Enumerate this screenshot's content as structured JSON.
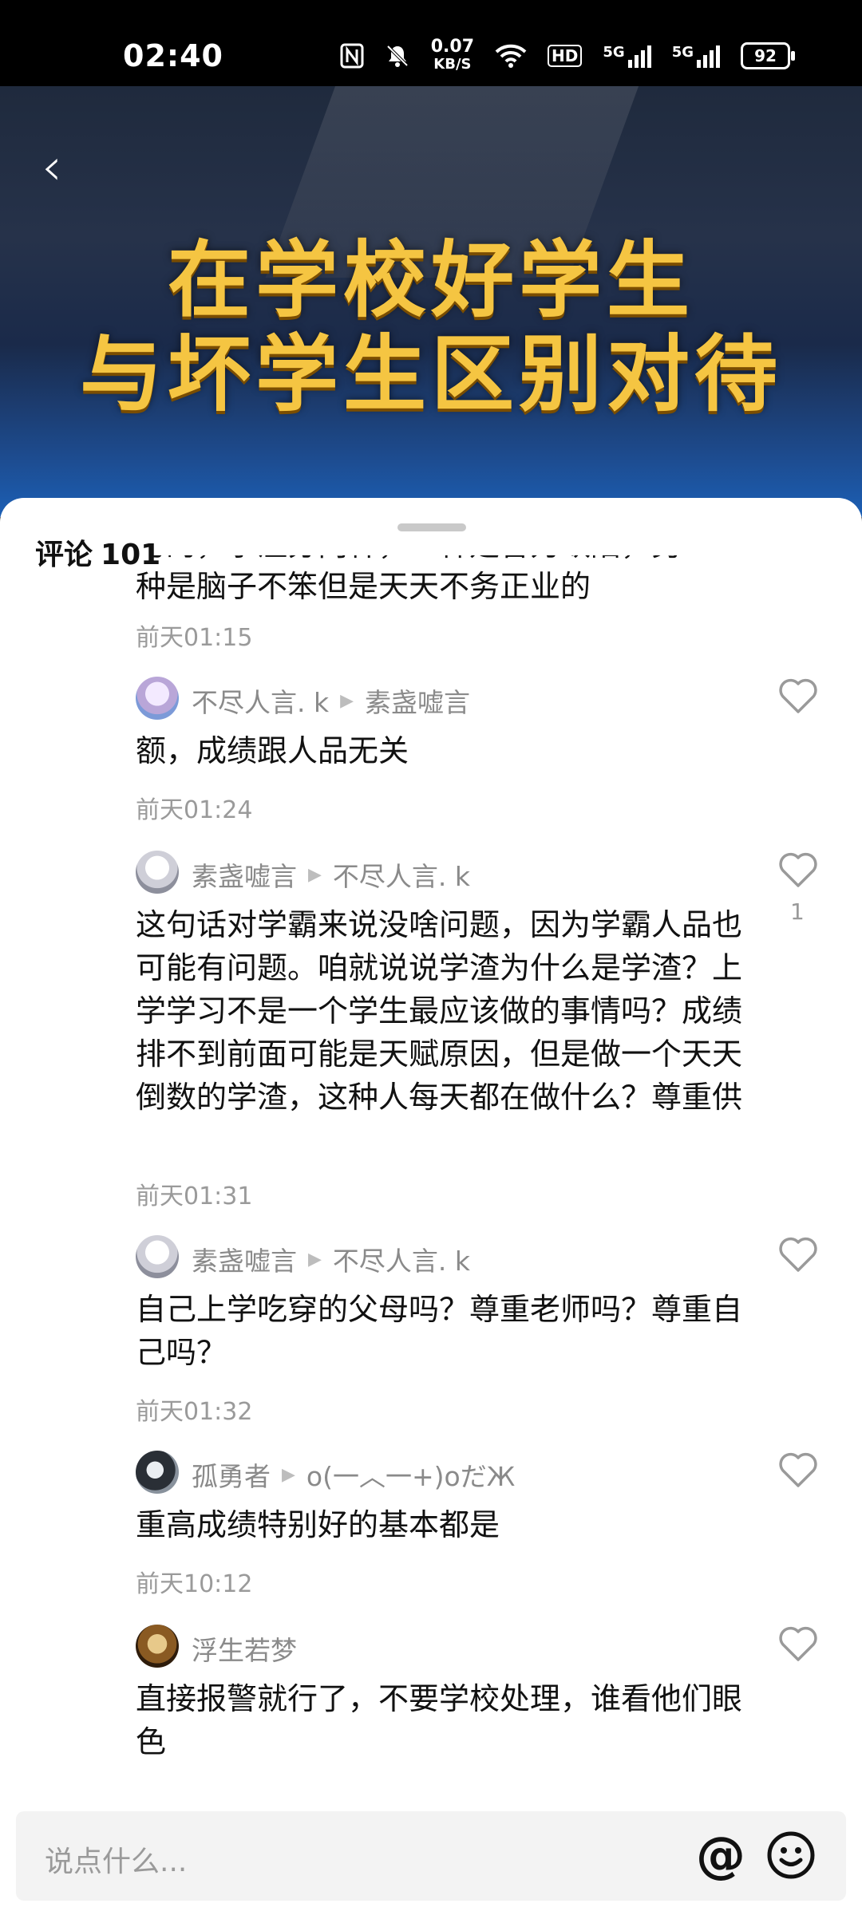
{
  "status_bar": {
    "time": "02:40",
    "net_speed_value": "0.07",
    "net_speed_unit": "KB/S",
    "hd_label": "HD",
    "signal1_label": "5G",
    "signal2_label": "5G",
    "battery": "92"
  },
  "video": {
    "headline_line1": "在学校好学生",
    "headline_line2": "与坏学生区别对待"
  },
  "comments_sheet": {
    "title": "评论",
    "count": "101",
    "comments": [
      {
        "body": "种是脑子不笨但是天天不务正业的",
        "partial_line": "习的，学渣分两种，一种是智力缺陷，另",
        "time": "前天01:15"
      },
      {
        "author": "不尽人言. k",
        "reply_to": "素盏嘘言",
        "body": "额，成绩跟人品无关",
        "time": "前天01:24",
        "likes": ""
      },
      {
        "author": "素盏嘘言",
        "reply_to": "不尽人言. k",
        "body": "这句话对学霸来说没啥问题，因为学霸人品也可能有问题。咱就说说学渣为什么是学渣？上学学习不是一个学生最应该做的事情吗？成绩排不到前面可能是天赋原因，但是做一个天天倒数的学渣，这种人每天都在做什么？尊重供",
        "time": "前天01:31",
        "likes": "1"
      },
      {
        "author": "素盏嘘言",
        "reply_to": "不尽人言. k",
        "body": "自己上学吃穿的父母吗？尊重老师吗？尊重自己吗？",
        "time": "前天01:32",
        "likes": ""
      },
      {
        "author": "孤勇者",
        "reply_to": "o(一︿一+)oだЖ",
        "body": "重高成绩特别好的基本都是",
        "time": "前天10:12",
        "likes": ""
      },
      {
        "author": "浮生若梦",
        "reply_to": "",
        "body": "直接报警就行了，不要学校处理，谁看他们眼色",
        "time": "",
        "likes": ""
      }
    ]
  },
  "input": {
    "placeholder": "说点什么...",
    "at_symbol": "@"
  },
  "colors": {
    "headline": "#f5c542",
    "meta_gray": "#8a8a8a"
  }
}
